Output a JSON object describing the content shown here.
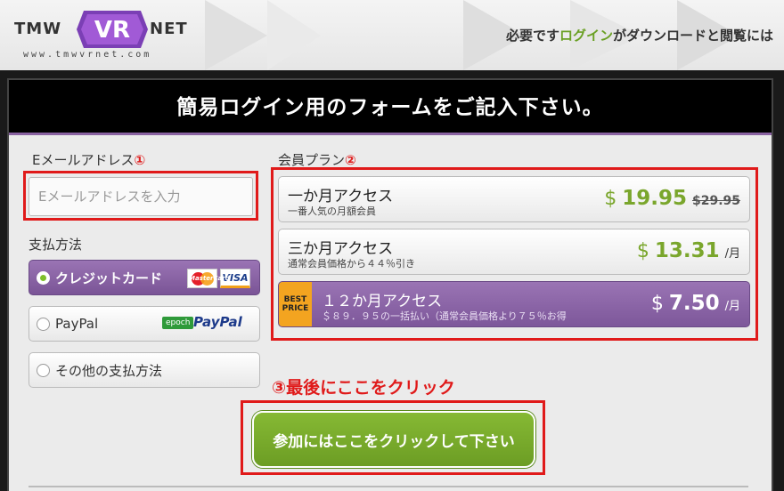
{
  "header": {
    "logo_left": "TMW",
    "logo_badge": "VR",
    "logo_right": "NET",
    "logo_sub": "www.tmwvrnet.com",
    "msg_part1": "必要です",
    "msg_login": "ログイン",
    "msg_part2": "がダウンロードと閲覧には"
  },
  "form": {
    "title": "簡易ログイン用のフォームをご記入下さい。",
    "email_label": "Eメールアドレス",
    "email_marker": "①",
    "email_placeholder": "Eメールアドレスを入力",
    "email_value": "",
    "payment_label": "支払方法",
    "payment_options": [
      {
        "label": "クレジットカード",
        "selected": true,
        "logos": [
          "MasterCard",
          "VISA"
        ]
      },
      {
        "label": "PayPal",
        "selected": false,
        "logos": [
          "epoch",
          "PayPal"
        ]
      },
      {
        "label": "その他の支払方法",
        "selected": false
      }
    ],
    "plan_label": "会員プラン",
    "plan_marker": "②",
    "plans": [
      {
        "name": "一か月アクセス",
        "sub": "一番人気の月額会員",
        "currency": "$",
        "price": "19.95",
        "original": "$29.95",
        "unit": ""
      },
      {
        "name": "三か月アクセス",
        "sub": "通常会員価格から４４％引き",
        "currency": "$",
        "price": "13.31",
        "unit": "/月"
      },
      {
        "name": "１２か月アクセス",
        "sub": "＄８９．９５の一括払い（通常会員価格より７５％お得",
        "currency": "$",
        "price": "7.50",
        "unit": "/月",
        "badge_line1": "BEST",
        "badge_line2": "PRICE",
        "selected": true
      }
    ],
    "click_note": "③最後にここをクリック",
    "submit_label": "参加にはここをクリックして下さい"
  },
  "colors": {
    "accent_purple": "#8a63a2",
    "accent_green": "#7aa62c",
    "highlight_red": "#e01a1a",
    "badge_orange": "#f3a420"
  }
}
